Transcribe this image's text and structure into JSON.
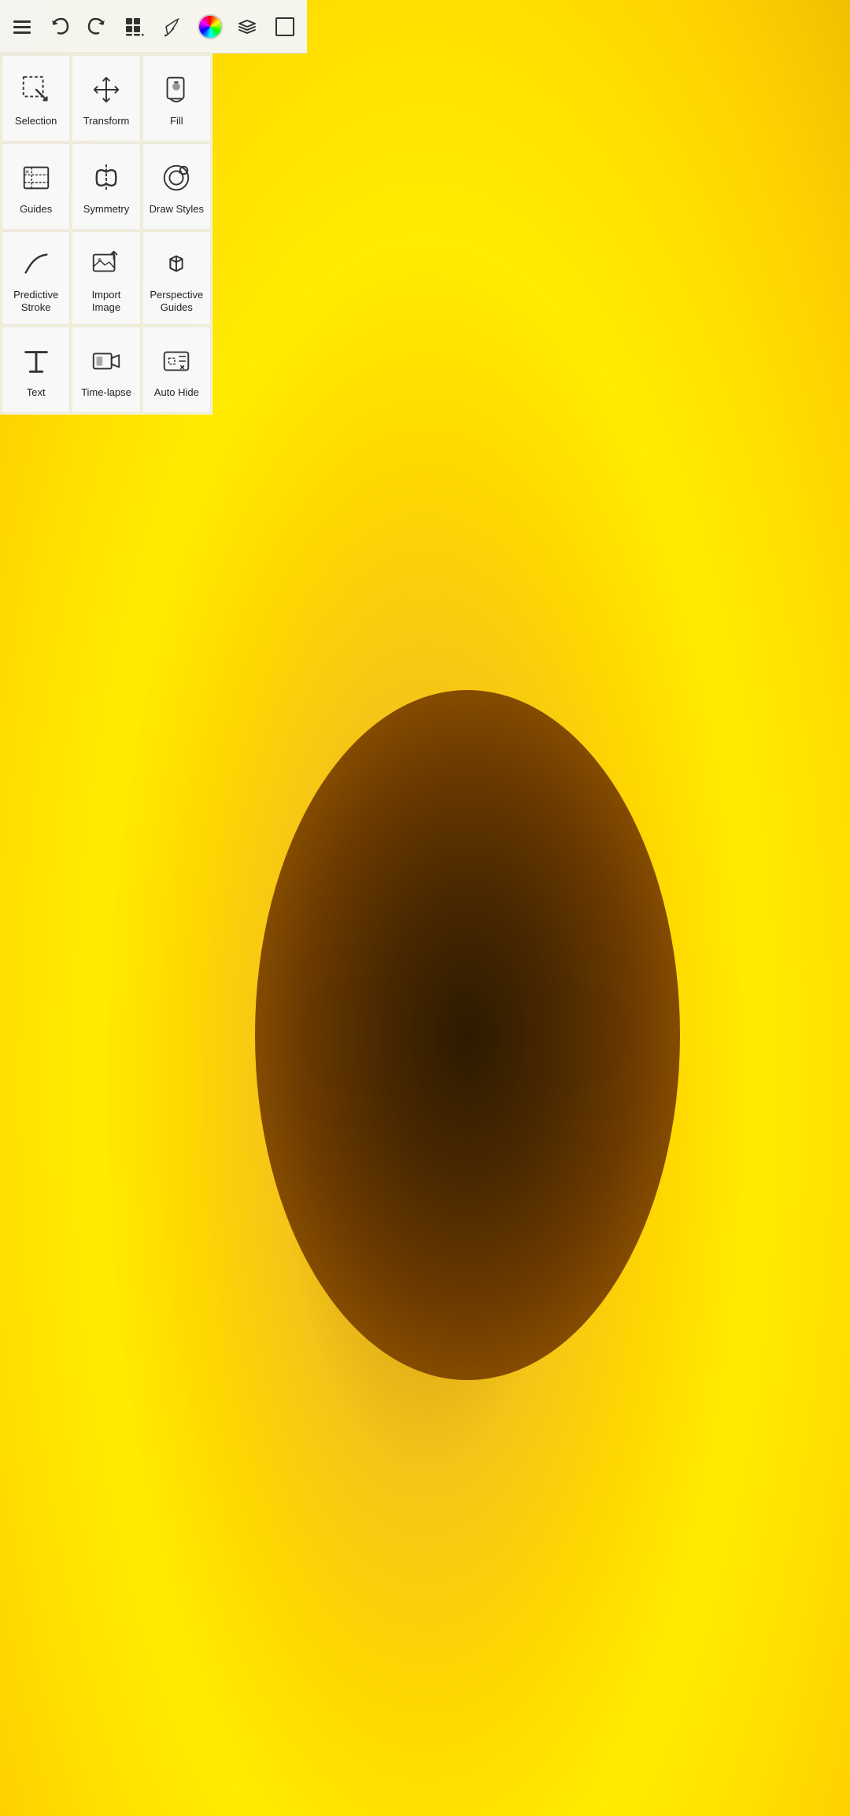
{
  "toolbar": {
    "menu_label": "Menu",
    "undo_label": "Undo",
    "redo_label": "Redo",
    "tools_label": "Tools",
    "brush_label": "Brush",
    "color_label": "Color",
    "layers_label": "Layers",
    "selection_tool_label": "Selection Tool"
  },
  "menu_items": [
    {
      "id": "selection",
      "label": "Selection",
      "icon": "selection-icon"
    },
    {
      "id": "transform",
      "label": "Transform",
      "icon": "transform-icon"
    },
    {
      "id": "fill",
      "label": "Fill",
      "icon": "fill-icon"
    },
    {
      "id": "guides",
      "label": "Guides",
      "icon": "guides-icon"
    },
    {
      "id": "symmetry",
      "label": "Symmetry",
      "icon": "symmetry-icon"
    },
    {
      "id": "draw-styles",
      "label": "Draw Styles",
      "icon": "draw-styles-icon"
    },
    {
      "id": "predictive-stroke",
      "label": "Predictive Stroke",
      "icon": "predictive-stroke-icon"
    },
    {
      "id": "import-image",
      "label": "Import Image",
      "icon": "import-image-icon"
    },
    {
      "id": "perspective-guides",
      "label": "Perspective Guides",
      "icon": "perspective-guides-icon"
    },
    {
      "id": "text",
      "label": "Text",
      "icon": "text-icon"
    },
    {
      "id": "time-lapse",
      "label": "Time-lapse",
      "icon": "time-lapse-icon"
    },
    {
      "id": "auto-hide",
      "label": "Auto Hide",
      "icon": "auto-hide-icon"
    }
  ]
}
